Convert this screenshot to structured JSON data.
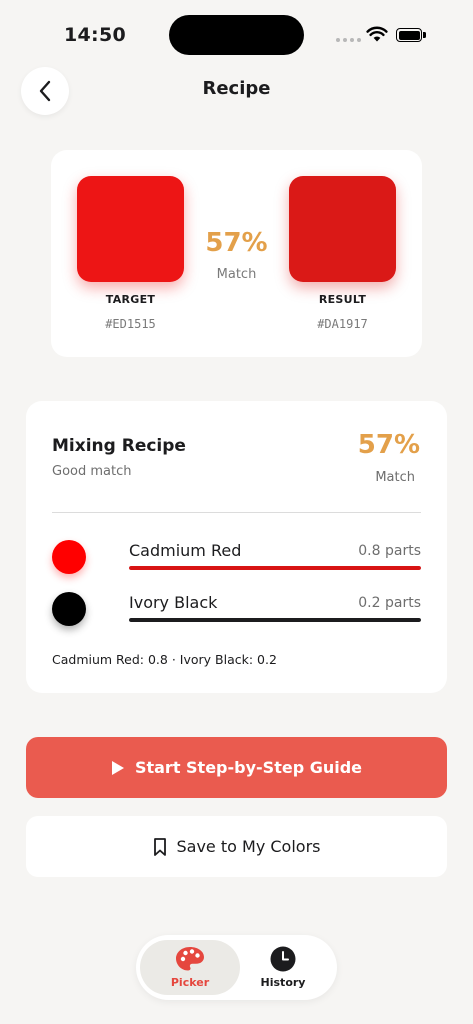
{
  "status_bar": {
    "time": "14:50"
  },
  "header": {
    "title": "Recipe"
  },
  "compare": {
    "target": {
      "label": "TARGET",
      "hex": "#ED1515",
      "color": "#ED1515"
    },
    "result": {
      "label": "RESULT",
      "hex": "#DA1917",
      "color": "#DA1917"
    },
    "match_percent": "57%",
    "match_label": "Match"
  },
  "recipe": {
    "title": "Mixing Recipe",
    "subtitle": "Good match",
    "match_percent": "57%",
    "match_label": "Match",
    "pigments": [
      {
        "name": "Cadmium Red",
        "parts": "0.8 parts",
        "color": "#FF0000",
        "fraction": 1.0,
        "bar_color": "#D81414"
      },
      {
        "name": "Ivory Black",
        "parts": "0.2 parts",
        "color": "#000000",
        "fraction": 1.0,
        "bar_color": "#1c1c1e"
      }
    ],
    "summary": "Cadmium Red: 0.8 · Ivory Black: 0.2"
  },
  "actions": {
    "guide_label": "Start Step-by-Step Guide",
    "save_label": "Save to My Colors"
  },
  "tabs": [
    {
      "label": "Picker",
      "icon": "palette-icon",
      "active": true
    },
    {
      "label": "History",
      "icon": "clock-icon",
      "active": false
    }
  ],
  "colors": {
    "accent": "#EA5B4F",
    "match": "#E3A04A",
    "background": "#f6f5f3"
  }
}
